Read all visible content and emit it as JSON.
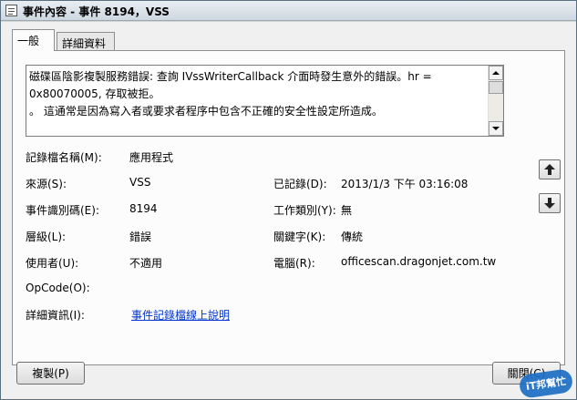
{
  "window": {
    "title": "事件內容 - 事件 8194，VSS"
  },
  "tabs": [
    {
      "label": "一般",
      "active": true
    },
    {
      "label": "詳細資料",
      "active": false
    }
  ],
  "description": {
    "text": "磁碟區陰影複製服務錯誤: 查詢 IVssWriterCallback 介面時發生意外的錯誤。hr = 0x80070005, 存取被拒。\n。 這通常是因為寫入者或要求者程序中包含不正確的安全性設定所造成。"
  },
  "fields": {
    "log_name_label": "記錄檔名稱(M):",
    "log_name_value": "應用程式",
    "source_label": "來源(S):",
    "source_value": "VSS",
    "logged_label": "已記錄(D):",
    "logged_value": "2013/1/3 下午 03:16:08",
    "event_id_label": "事件識別碼(E):",
    "event_id_value": "8194",
    "task_category_label": "工作類別(Y):",
    "task_category_value": "無",
    "level_label": "層級(L):",
    "level_value": "錯誤",
    "keywords_label": "關鍵字(K):",
    "keywords_value": "傳統",
    "user_label": "使用者(U):",
    "user_value": "不適用",
    "computer_label": "電腦(R):",
    "computer_value": "officescan.dragonjet.com.tw",
    "opcode_label": "OpCode(O):",
    "more_info_label": "詳細資訊(I):",
    "more_info_link": "事件記錄檔線上說明"
  },
  "buttons": {
    "copy": "複製(P)",
    "close": "關閉(C)"
  },
  "icons": {
    "nav_up": "up-arrow-icon",
    "nav_down": "down-arrow-icon"
  },
  "watermark": "iT邦幫忙",
  "colors": {
    "link": "#0033cc",
    "watermark": "#1d6fc4"
  }
}
